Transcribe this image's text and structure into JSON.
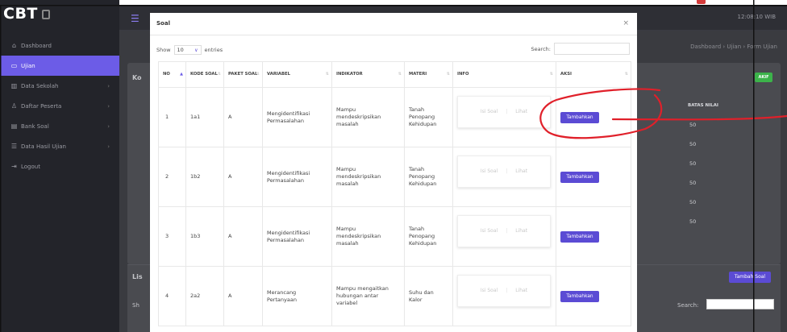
{
  "app": {
    "logo": "CBT",
    "clock": "12:08:10 WIB",
    "breadcrumb": "Dashboard  ›  Ujian  ›  Form Ujian"
  },
  "sidebar": {
    "items": [
      {
        "label": "Dashboard",
        "icon": "home-icon",
        "active": false
      },
      {
        "label": "Ujian",
        "icon": "calendar-icon",
        "active": true
      },
      {
        "label": "Data Sekolah",
        "icon": "building-icon",
        "active": false
      },
      {
        "label": "Daftar Peserta",
        "icon": "user-icon",
        "active": false
      },
      {
        "label": "Bank Soal",
        "icon": "database-icon",
        "active": false
      },
      {
        "label": "Data Hasil Ujian",
        "icon": "table-icon",
        "active": false
      },
      {
        "label": "Logout",
        "icon": "logout-icon",
        "active": false
      }
    ]
  },
  "background": {
    "card_title": "Ko",
    "green_button": "AKIF",
    "batas_nilai_header": "BATAS NILAI",
    "batas_nilai_values": [
      "50",
      "50",
      "50",
      "50",
      "50",
      "50"
    ],
    "list_title": "Lis",
    "show_label": "Sh",
    "tambah_soal": "Tambah Soal",
    "search_label": "Search:"
  },
  "modal": {
    "title": "Soal",
    "close": "×",
    "show": "Show",
    "entries_value": "10",
    "entries": "entries",
    "search_label": "Search:",
    "columns": [
      "NO",
      "KODE SOAL",
      "PAKET SOAL",
      "VARIABEL",
      "INDIKATOR",
      "MATERI",
      "INFO",
      "AKSI"
    ],
    "info_isi": "Isi Soal",
    "info_lihat": "Lihat",
    "action_label": "Tambahkan",
    "rows": [
      {
        "no": "1",
        "kode": "1a1",
        "paket": "A",
        "variabel": "Mengidentifikasi Permasalahan",
        "indikator": "Mampu mendeskripsikan masalah",
        "materi": "Tanah Penopang Kehidupan"
      },
      {
        "no": "2",
        "kode": "1b2",
        "paket": "A",
        "variabel": "Mengidentifikasi Permasalahan",
        "indikator": "Mampu mendeskripsikan masalah",
        "materi": "Tanah Penopang Kehidupan"
      },
      {
        "no": "3",
        "kode": "1b3",
        "paket": "A",
        "variabel": "Mengidentifikasi Permasalahan",
        "indikator": "Mampu mendeskripsikan masalah",
        "materi": "Tanah Penopang Kehidupan"
      },
      {
        "no": "4",
        "kode": "2a2",
        "paket": "A",
        "variabel": "Merancang Pertanyaan",
        "indikator": "Mampu mengaitkan hubungan antar variabel",
        "materi": "Suhu dan Kalor"
      }
    ]
  },
  "colors": {
    "accent": "#5b4bd4",
    "sidebar_active": "#6c5ce7",
    "annotation": "#e0202a",
    "success": "#3cb34a"
  }
}
